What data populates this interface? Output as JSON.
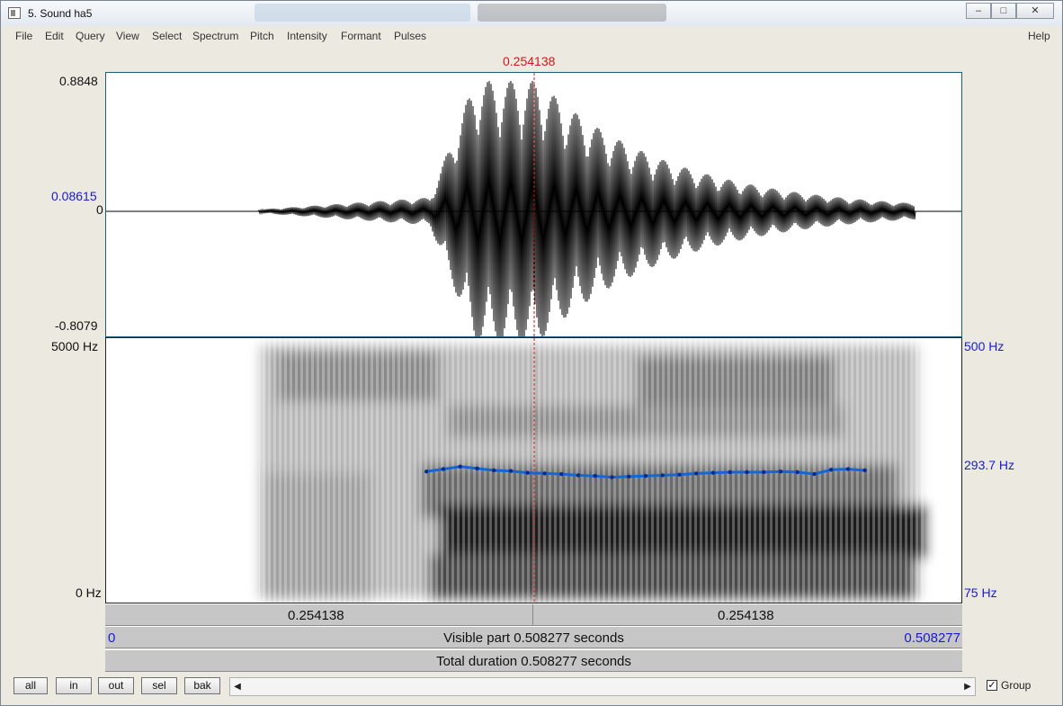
{
  "window": {
    "title": "5. Sound ha5",
    "minimize": "‒",
    "maximize": "□",
    "close": "✕"
  },
  "menu": [
    "File",
    "Edit",
    "Query",
    "View",
    "Select",
    "Spectrum",
    "Pitch",
    "Intensity",
    "Formant",
    "Pulses"
  ],
  "help": "Help",
  "cursor_time": "0.254138",
  "waveform": {
    "y_max": "0.8848",
    "y_cursor": "0.08615",
    "y_zero": "0",
    "y_min": "-0.8079"
  },
  "spectrogram": {
    "freq_top": "5000 Hz",
    "freq_bottom": "0 Hz",
    "pitch_top": "500 Hz",
    "pitch_cursor": "293.7 Hz",
    "pitch_bottom": "75 Hz"
  },
  "time_bar": {
    "left": "0.254138",
    "right": "0.254138"
  },
  "visible_bar": {
    "start": "0",
    "label": "Visible part 0.508277 seconds",
    "end": "0.508277"
  },
  "total_bar": "Total duration 0.508277 seconds",
  "buttons": [
    "all",
    "in",
    "out",
    "sel",
    "bak"
  ],
  "scroll_left": "◀",
  "scroll_right": "▶",
  "group": {
    "label": "Group",
    "checked": "✓"
  },
  "colors": {
    "accent": "#1a1ad0",
    "cursor": "#d01818",
    "pitch": "#1566d6"
  },
  "chart_data": {
    "type": "line",
    "x_unit": "s",
    "xlim": [
      0,
      0.508277
    ],
    "ylim": [
      75,
      500
    ],
    "pitch_points": [
      [
        0.19,
        287
      ],
      [
        0.2,
        291
      ],
      [
        0.21,
        295
      ],
      [
        0.22,
        292
      ],
      [
        0.23,
        289
      ],
      [
        0.24,
        288
      ],
      [
        0.25,
        285
      ],
      [
        0.26,
        284
      ],
      [
        0.27,
        283
      ],
      [
        0.28,
        281
      ],
      [
        0.29,
        280
      ],
      [
        0.3,
        278
      ],
      [
        0.31,
        279
      ],
      [
        0.32,
        280
      ],
      [
        0.33,
        281
      ],
      [
        0.34,
        282
      ],
      [
        0.35,
        284
      ],
      [
        0.36,
        285
      ],
      [
        0.37,
        286
      ],
      [
        0.38,
        286
      ],
      [
        0.39,
        286
      ],
      [
        0.4,
        287
      ],
      [
        0.41,
        286
      ],
      [
        0.42,
        283
      ],
      [
        0.43,
        290
      ],
      [
        0.44,
        291
      ],
      [
        0.45,
        289
      ]
    ]
  }
}
